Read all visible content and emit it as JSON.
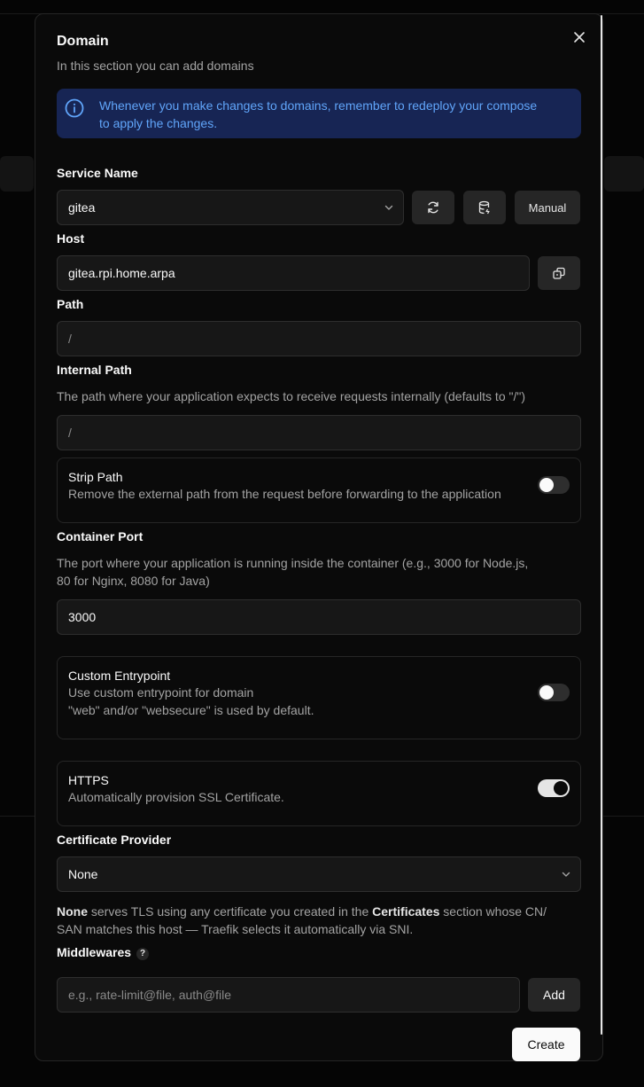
{
  "dialog": {
    "title": "Domain",
    "subtitle": "In this section you can add domains",
    "alert_line1": "Whenever you make changes to domains, remember to redeploy your compose",
    "alert_line2": "to apply the changes."
  },
  "service": {
    "label": "Service Name",
    "value": "gitea",
    "manual_label": "Manual"
  },
  "host": {
    "label": "Host",
    "value": "gitea.rpi.home.arpa"
  },
  "path": {
    "label": "Path",
    "value": "/"
  },
  "internal_path": {
    "label": "Internal Path",
    "description": "The path where your application expects to receive requests internally (defaults to \"/\")",
    "value": "/"
  },
  "strip_path": {
    "title": "Strip Path",
    "description": "Remove the external path from the request before forwarding to the application",
    "enabled": false
  },
  "container_port": {
    "label": "Container Port",
    "description_line1": "The port where your application is running inside the container (e.g., 3000 for Node.js,",
    "description_line2": "80 for Nginx, 8080 for Java)",
    "value": "3000"
  },
  "custom_entrypoint": {
    "title": "Custom Entrypoint",
    "description_line1": "Use custom entrypoint for domain",
    "description_line2": "\"web\" and/or \"websecure\" is used by default.",
    "enabled": false
  },
  "https": {
    "title": "HTTPS",
    "description": "Automatically provision SSL Certificate.",
    "enabled": true
  },
  "certificate": {
    "label": "Certificate Provider",
    "value": "None",
    "help_bold1": "None",
    "help_part1": " serves TLS using any certificate you created in the ",
    "help_bold2": "Certificates",
    "help_part2": " section whose CN/",
    "help_line2": "SAN matches this host — Traefik selects it automatically via SNI."
  },
  "middlewares": {
    "label": "Middlewares",
    "help_badge": "?",
    "placeholder": "e.g., rate-limit@file, auth@file",
    "add_label": "Add"
  },
  "create_label": "Create",
  "colors": {
    "accent_info_bg": "#172554",
    "accent_info_text": "#60a5fa"
  }
}
